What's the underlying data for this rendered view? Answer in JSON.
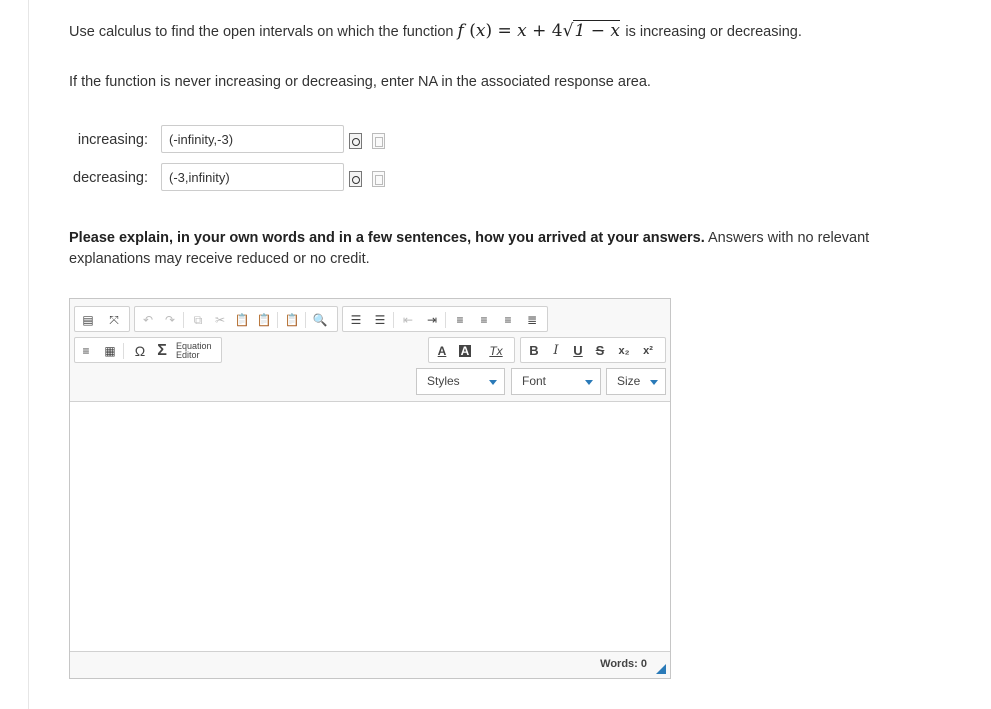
{
  "question": {
    "prefix": "Use calculus to find the open intervals on which the function",
    "suffix": "is increasing or decreasing.",
    "function_expr": {
      "f": "f",
      "x": "x",
      "lhs_close": ") =",
      "plus": "+",
      "coef": "4",
      "radicand": "1 − x"
    },
    "note": "If the function is never increasing or decreasing, enter NA in the associated response area."
  },
  "answers": [
    {
      "label": "increasing:",
      "value": "(-infinity,-3)"
    },
    {
      "label": "decreasing:",
      "value": "(-3,infinity)"
    }
  ],
  "explain": {
    "bold": "Please explain, in your own words and in a few sentences, how you arrived at your answers.",
    "rest": "Answers with no relevant explanations may receive reduced or no credit."
  },
  "editor": {
    "equation_label_1": "Equation",
    "equation_label_2": "Editor",
    "styles_label": "Styles",
    "font_label": "Font",
    "size_label": "Size",
    "words_label": "Words: 0",
    "glyphs": {
      "omega": "Ω",
      "sigma": "Σ",
      "bold": "B",
      "italic": "I",
      "underline": "U",
      "strike": "S",
      "sub": "x₂",
      "sup": "x²",
      "font_color": "A",
      "bg_color": "A",
      "clear": "Tx"
    },
    "accent": "#2a7ab8"
  }
}
